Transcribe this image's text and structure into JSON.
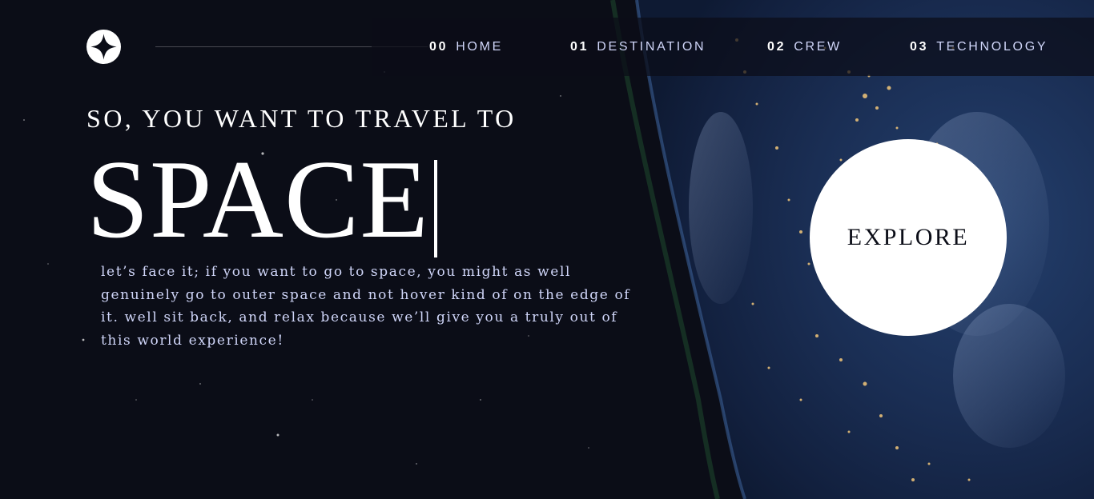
{
  "header": {
    "logo_icon": "four-point-star-icon",
    "nav": [
      {
        "num": "00",
        "label": "HOME"
      },
      {
        "num": "01",
        "label": "DESTINATION"
      },
      {
        "num": "02",
        "label": "CREW"
      },
      {
        "num": "03",
        "label": "TECHNOLOGY"
      }
    ]
  },
  "hero": {
    "subtitle": "SO, YOU WANT TO TRAVEL TO",
    "title": "SPACE",
    "description": "let’s face it; if you want to go to space, you might as well genuinely go to outer space and not hover kind of on the edge of it. well sit back, and relax because we’ll give you a truly out of this world experience!",
    "explore_label": "EXPLORE"
  },
  "colors": {
    "background": "#0b0d17",
    "text_light": "#d0d6f9",
    "white": "#ffffff"
  }
}
